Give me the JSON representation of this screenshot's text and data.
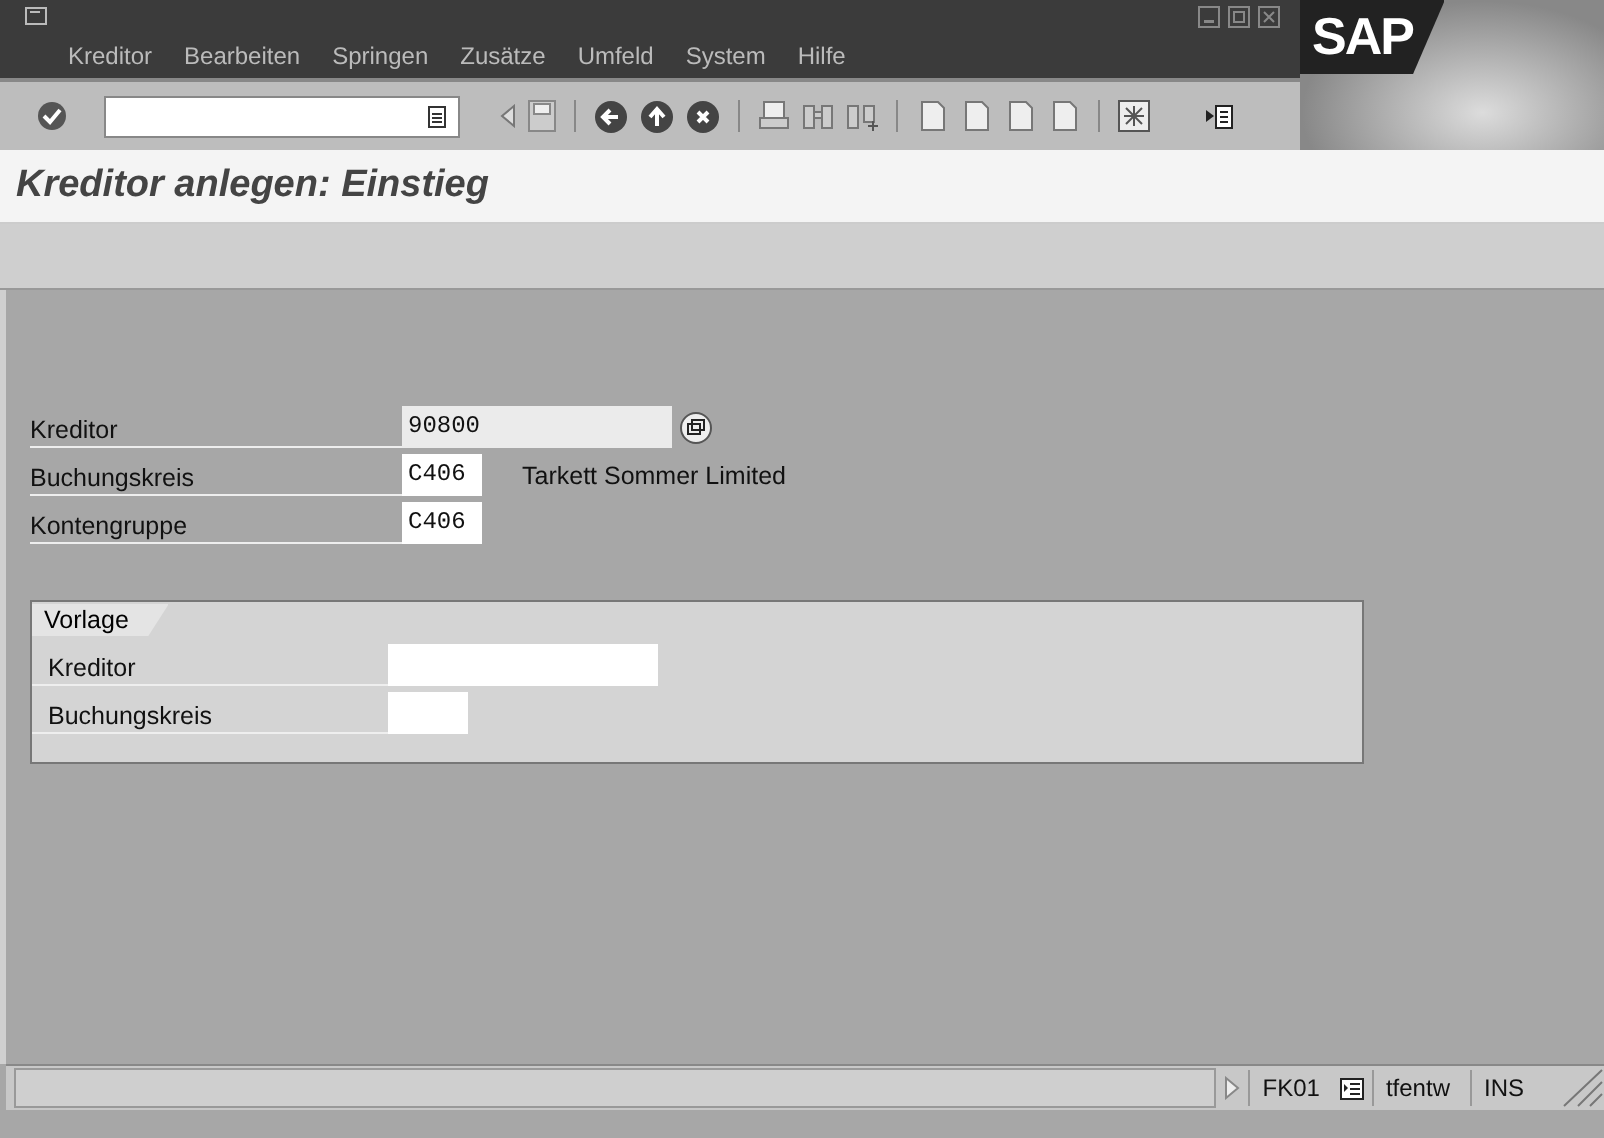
{
  "menu": [
    "Kreditor",
    "Bearbeiten",
    "Springen",
    "Zusätze",
    "Umfeld",
    "System",
    "Hilfe"
  ],
  "logo": "SAP",
  "title": "Kreditor anlegen: Einstieg",
  "fields": [
    {
      "label": "Kreditor",
      "value": "90800",
      "wide": true,
      "matchcode": true
    },
    {
      "label": "Buchungskreis",
      "value": "C406",
      "wide": false,
      "matchcode": false,
      "description": "Tarkett Sommer Limited"
    },
    {
      "label": "Kontengruppe",
      "value": "C406",
      "wide": false,
      "matchcode": false
    }
  ],
  "group": {
    "title": "Vorlage",
    "fields": [
      {
        "label": "Kreditor",
        "wide": true
      },
      {
        "label": "Buchungskreis",
        "wide": false
      }
    ]
  },
  "status_bar": {
    "transaction": "FK01",
    "server": "tfentw",
    "mode": "INS"
  }
}
